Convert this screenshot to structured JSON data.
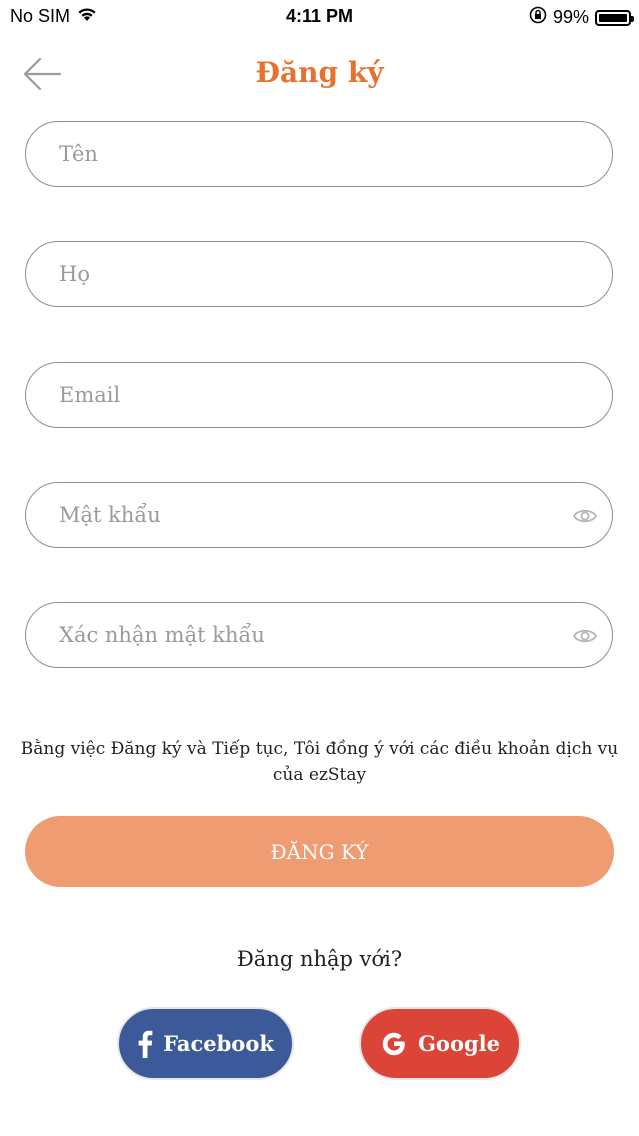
{
  "status_bar": {
    "carrier": "No SIM",
    "time": "4:11 PM",
    "battery_percent": "99%",
    "battery_level": 0.99
  },
  "header": {
    "title": "Đăng ký",
    "back_icon": "arrow-left-icon"
  },
  "form": {
    "first_name_placeholder": "Tên",
    "last_name_placeholder": "Họ",
    "email_placeholder": "Email",
    "password_placeholder": "Mật khẩu",
    "confirm_password_placeholder": "Xác nhận mật khẩu",
    "eye_icon": "eye-icon"
  },
  "terms_text": "Bằng việc Đăng ký và Tiếp tục, Tôi đồng ý với các điều khoản dịch vụ của ezStay",
  "signup_label": "ĐĂNG KÝ",
  "login_with_label": "Đăng nhập với?",
  "social": {
    "facebook_label": "Facebook",
    "google_label": "Google"
  },
  "colors": {
    "accent": "#E8712E",
    "signup_button": "#F09C72",
    "facebook": "#3C5A99",
    "google": "#DB4437",
    "field_border": "#8e8e93"
  }
}
